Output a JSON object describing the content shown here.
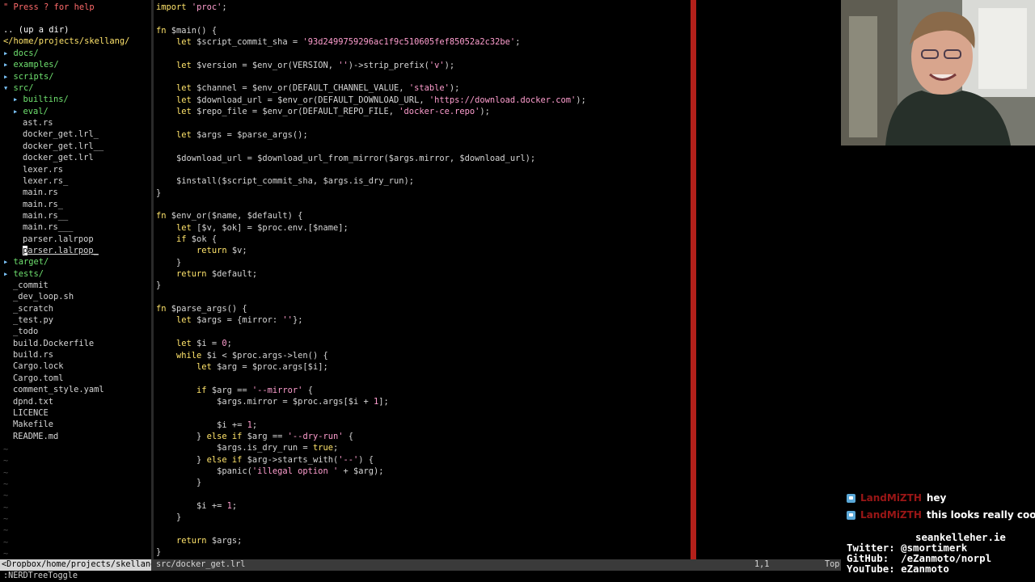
{
  "tree": {
    "help": "\" Press ? for help",
    "updir": ".. (up a dir)",
    "root": "</home/projects/skellang/",
    "entries": [
      {
        "arrow": "▸ ",
        "name": "docs/",
        "indent": 0,
        "type": "dir"
      },
      {
        "arrow": "▸ ",
        "name": "examples/",
        "indent": 0,
        "type": "dir"
      },
      {
        "arrow": "▸ ",
        "name": "scripts/",
        "indent": 0,
        "type": "dir"
      },
      {
        "arrow": "▾ ",
        "name": "src/",
        "indent": 0,
        "type": "dir"
      },
      {
        "arrow": "▸ ",
        "name": "builtins/",
        "indent": 1,
        "type": "dir"
      },
      {
        "arrow": "▸ ",
        "name": "eval/",
        "indent": 1,
        "type": "dir"
      },
      {
        "arrow": "",
        "name": "ast.rs",
        "indent": 1,
        "type": "file"
      },
      {
        "arrow": "",
        "name": "docker_get.lrl_",
        "indent": 1,
        "type": "file"
      },
      {
        "arrow": "",
        "name": "docker_get.lrl__",
        "indent": 1,
        "type": "file"
      },
      {
        "arrow": "",
        "name": "docker_get.lrl",
        "indent": 1,
        "type": "file"
      },
      {
        "arrow": "",
        "name": "lexer.rs",
        "indent": 1,
        "type": "file"
      },
      {
        "arrow": "",
        "name": "lexer.rs_",
        "indent": 1,
        "type": "file"
      },
      {
        "arrow": "",
        "name": "main.rs",
        "indent": 1,
        "type": "file"
      },
      {
        "arrow": "",
        "name": "main.rs_",
        "indent": 1,
        "type": "file"
      },
      {
        "arrow": "",
        "name": "main.rs__",
        "indent": 1,
        "type": "file"
      },
      {
        "arrow": "",
        "name": "main.rs___",
        "indent": 1,
        "type": "file"
      },
      {
        "arrow": "",
        "name": "parser.lalrpop",
        "indent": 1,
        "type": "file"
      },
      {
        "arrow": "",
        "name": "parser.lalrpop_",
        "indent": 1,
        "type": "file",
        "cursor": true
      },
      {
        "arrow": "▸ ",
        "name": "target/",
        "indent": 0,
        "type": "dir"
      },
      {
        "arrow": "▸ ",
        "name": "tests/",
        "indent": 0,
        "type": "dir"
      },
      {
        "arrow": "",
        "name": "_commit",
        "indent": 0,
        "type": "file"
      },
      {
        "arrow": "",
        "name": "_dev_loop.sh",
        "indent": 0,
        "type": "file"
      },
      {
        "arrow": "",
        "name": "_scratch",
        "indent": 0,
        "type": "file"
      },
      {
        "arrow": "",
        "name": "_test.py",
        "indent": 0,
        "type": "file"
      },
      {
        "arrow": "",
        "name": "_todo",
        "indent": 0,
        "type": "file"
      },
      {
        "arrow": "",
        "name": "build.Dockerfile",
        "indent": 0,
        "type": "file"
      },
      {
        "arrow": "",
        "name": "build.rs",
        "indent": 0,
        "type": "file"
      },
      {
        "arrow": "",
        "name": "Cargo.lock",
        "indent": 0,
        "type": "file"
      },
      {
        "arrow": "",
        "name": "Cargo.toml",
        "indent": 0,
        "type": "file"
      },
      {
        "arrow": "",
        "name": "comment_style.yaml",
        "indent": 0,
        "type": "file"
      },
      {
        "arrow": "",
        "name": "dpnd.txt",
        "indent": 0,
        "type": "file"
      },
      {
        "arrow": "",
        "name": "LICENCE",
        "indent": 0,
        "type": "file"
      },
      {
        "arrow": "",
        "name": "Makefile",
        "indent": 0,
        "type": "file"
      },
      {
        "arrow": "",
        "name": "README.md",
        "indent": 0,
        "type": "file"
      }
    ],
    "tilde": "~"
  },
  "code": {
    "lines": [
      [
        [
          "kw",
          "import"
        ],
        [
          "pl",
          " "
        ],
        [
          "str",
          "'proc'"
        ],
        [
          "pl",
          ";"
        ]
      ],
      [],
      [
        [
          "kw",
          "fn"
        ],
        [
          "pl",
          " $main() {"
        ]
      ],
      [
        [
          "pl",
          "    "
        ],
        [
          "kw",
          "let"
        ],
        [
          "pl",
          " $script_commit_sha = "
        ],
        [
          "str",
          "'93d2499759296ac1f9c510605fef85052a2c32be'"
        ],
        [
          "pl",
          ";"
        ]
      ],
      [],
      [
        [
          "pl",
          "    "
        ],
        [
          "kw",
          "let"
        ],
        [
          "pl",
          " $version = $env_or(VERSION, "
        ],
        [
          "str",
          "''"
        ],
        [
          "pl",
          ")->strip_prefix("
        ],
        [
          "str",
          "'v'"
        ],
        [
          "pl",
          ");"
        ]
      ],
      [],
      [
        [
          "pl",
          "    "
        ],
        [
          "kw",
          "let"
        ],
        [
          "pl",
          " $channel = $env_or(DEFAULT_CHANNEL_VALUE, "
        ],
        [
          "str",
          "'stable'"
        ],
        [
          "pl",
          ");"
        ]
      ],
      [
        [
          "pl",
          "    "
        ],
        [
          "kw",
          "let"
        ],
        [
          "pl",
          " $download_url = $env_or(DEFAULT_DOWNLOAD_URL, "
        ],
        [
          "str",
          "'https://download.docker.com'"
        ],
        [
          "pl",
          ");"
        ]
      ],
      [
        [
          "pl",
          "    "
        ],
        [
          "kw",
          "let"
        ],
        [
          "pl",
          " $repo_file = $env_or(DEFAULT_REPO_FILE, "
        ],
        [
          "str",
          "'docker-ce.repo'"
        ],
        [
          "pl",
          ");"
        ]
      ],
      [],
      [
        [
          "pl",
          "    "
        ],
        [
          "kw",
          "let"
        ],
        [
          "pl",
          " $args = $parse_args();"
        ]
      ],
      [],
      [
        [
          "pl",
          "    $download_url = $download_url_from_mirror($args.mirror, $download_url);"
        ]
      ],
      [],
      [
        [
          "pl",
          "    $install($script_commit_sha, $args.is_dry_run);"
        ]
      ],
      [
        [
          "pl",
          "}"
        ]
      ],
      [],
      [
        [
          "kw",
          "fn"
        ],
        [
          "pl",
          " $env_or($name, $default) {"
        ]
      ],
      [
        [
          "pl",
          "    "
        ],
        [
          "kw",
          "let"
        ],
        [
          "pl",
          " [$v, $ok] = $proc.env.[$name];"
        ]
      ],
      [
        [
          "pl",
          "    "
        ],
        [
          "kw",
          "if"
        ],
        [
          "pl",
          " $ok {"
        ]
      ],
      [
        [
          "pl",
          "        "
        ],
        [
          "kw",
          "return"
        ],
        [
          "pl",
          " $v;"
        ]
      ],
      [
        [
          "pl",
          "    }"
        ]
      ],
      [
        [
          "pl",
          "    "
        ],
        [
          "kw",
          "return"
        ],
        [
          "pl",
          " $default;"
        ]
      ],
      [
        [
          "pl",
          "}"
        ]
      ],
      [],
      [
        [
          "kw",
          "fn"
        ],
        [
          "pl",
          " $parse_args() {"
        ]
      ],
      [
        [
          "pl",
          "    "
        ],
        [
          "kw",
          "let"
        ],
        [
          "pl",
          " $args = {mirror: "
        ],
        [
          "str",
          "''"
        ],
        [
          "pl",
          "};"
        ]
      ],
      [],
      [
        [
          "pl",
          "    "
        ],
        [
          "kw",
          "let"
        ],
        [
          "pl",
          " $i = "
        ],
        [
          "num",
          "0"
        ],
        [
          "pl",
          ";"
        ]
      ],
      [
        [
          "pl",
          "    "
        ],
        [
          "kw",
          "while"
        ],
        [
          "pl",
          " $i < $proc.args->len() {"
        ]
      ],
      [
        [
          "pl",
          "        "
        ],
        [
          "kw",
          "let"
        ],
        [
          "pl",
          " $arg = $proc.args[$i];"
        ]
      ],
      [],
      [
        [
          "pl",
          "        "
        ],
        [
          "kw",
          "if"
        ],
        [
          "pl",
          " $arg == "
        ],
        [
          "str",
          "'--mirror'"
        ],
        [
          "pl",
          " {"
        ]
      ],
      [
        [
          "pl",
          "            $args.mirror = $proc.args[$i + "
        ],
        [
          "num",
          "1"
        ],
        [
          "pl",
          "];"
        ]
      ],
      [],
      [
        [
          "pl",
          "            $i += "
        ],
        [
          "num",
          "1"
        ],
        [
          "pl",
          ";"
        ]
      ],
      [
        [
          "pl",
          "        } "
        ],
        [
          "kw",
          "else if"
        ],
        [
          "pl",
          " $arg == "
        ],
        [
          "str",
          "'--dry-run'"
        ],
        [
          "pl",
          " {"
        ]
      ],
      [
        [
          "pl",
          "            $args.is_dry_run = "
        ],
        [
          "kw",
          "true"
        ],
        [
          "pl",
          ";"
        ]
      ],
      [
        [
          "pl",
          "        } "
        ],
        [
          "kw",
          "else if"
        ],
        [
          "pl",
          " $arg->starts_with("
        ],
        [
          "str",
          "'--'"
        ],
        [
          "pl",
          ") {"
        ]
      ],
      [
        [
          "pl",
          "            $panic("
        ],
        [
          "str",
          "'illegal option '"
        ],
        [
          "pl",
          " + $arg);"
        ]
      ],
      [
        [
          "pl",
          "        }"
        ]
      ],
      [],
      [
        [
          "pl",
          "        $i += "
        ],
        [
          "num",
          "1"
        ],
        [
          "pl",
          ";"
        ]
      ],
      [
        [
          "pl",
          "    }"
        ]
      ],
      [],
      [
        [
          "pl",
          "    "
        ],
        [
          "kw",
          "return"
        ],
        [
          "pl",
          " $args;"
        ]
      ],
      [
        [
          "pl",
          "}"
        ]
      ]
    ]
  },
  "status": {
    "left": "<Dropbox/home/projects/skellang",
    "file": "src/docker_get.lrl",
    "position": "1,1",
    "percent": "Top"
  },
  "cmdline": ":NERDTreeToggle",
  "chat": [
    {
      "user": "LandMiZTH",
      "message": "hey"
    },
    {
      "user": "LandMiZTH",
      "message": "this looks really cool"
    }
  ],
  "social": {
    "website": "seankelleher.ie",
    "twitter": "Twitter: @smortimerk",
    "github": "GitHub:  /eZanmoto/norpl",
    "youtube": "YouTube: eZanmoto"
  },
  "colors": {
    "keyword": "#ffe46b",
    "string": "#ff9ecf",
    "directory": "#6fe16f",
    "colorcolumn": "#b3201a"
  }
}
